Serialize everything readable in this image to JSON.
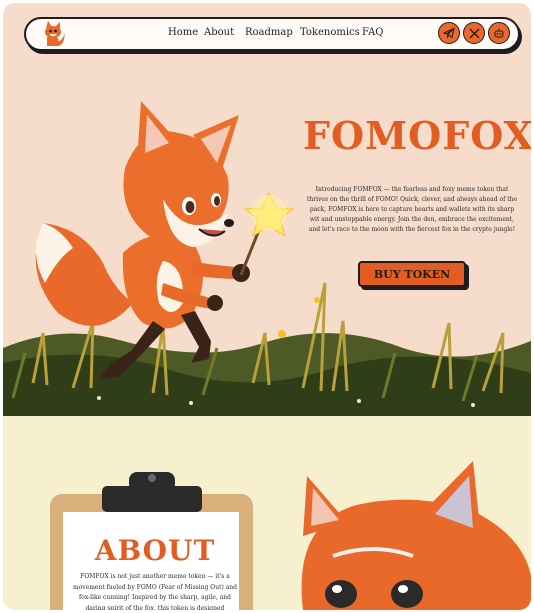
{
  "colors": {
    "hero_bg": "#f6dccb",
    "about_bg": "#f7f0cf",
    "accent": "#e35d22",
    "ink": "#1d1d1d"
  },
  "nav": {
    "logo_icon": "fox-logo-icon",
    "links": [
      "Home",
      "About",
      "Roadmap",
      "Tokenomics",
      "FAQ"
    ],
    "socials": [
      {
        "name": "telegram",
        "icon": "telegram-icon"
      },
      {
        "name": "x",
        "icon": "x-icon"
      },
      {
        "name": "other",
        "icon": "bot-icon"
      }
    ]
  },
  "hero": {
    "title": "FOMOFOX",
    "description": "Introducing FOMFOX — the fearless and foxy meme token that thrives on the thrill of FOMO! Quick, clever, and always ahead of the pack, FOMFOX is here to capture hearts and wallets with its sharp wit and unstoppable energy. Join the den, embrace the excitement, and let's race to the moon with the fiercest fox in the crypto jungle!",
    "cta_label": "BUY TOKEN"
  },
  "about": {
    "title": "ABOUT",
    "text": "FOMFOX is not just another meme token — it's a movement fueled by FOMO (Fear of Missing Out) and fox-like cunning! Inspired by the sharp, agile, and daring spirit of the fox, this token is designed"
  }
}
